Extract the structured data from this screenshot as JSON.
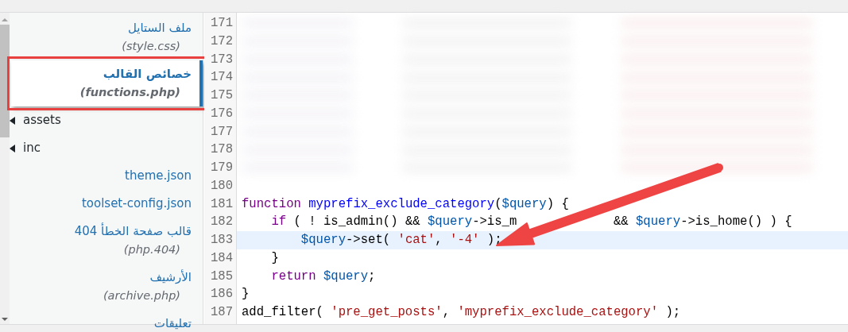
{
  "sidebar": {
    "items": [
      {
        "kind": "file",
        "title": "ملف الستايل",
        "subtitle": "(style.css)",
        "selected": false,
        "outlined": false
      },
      {
        "kind": "file",
        "title": "خصائص القالب",
        "subtitle": "(functions.php)",
        "selected": true,
        "outlined": true
      },
      {
        "kind": "folder",
        "title": "assets",
        "expanded": false
      },
      {
        "kind": "folder",
        "title": "inc",
        "expanded": false
      },
      {
        "kind": "file",
        "title": "theme.json",
        "selected": false,
        "outlined": false
      },
      {
        "kind": "file",
        "title": "toolset-config.json",
        "selected": false,
        "outlined": false
      },
      {
        "kind": "file",
        "title": "قالب صفحة الخطأ 404",
        "subtitle": "(php.404)",
        "selected": false,
        "outlined": false
      },
      {
        "kind": "file",
        "title": "الأرشيف",
        "subtitle": "(archive.php)",
        "selected": false,
        "outlined": false
      },
      {
        "kind": "file",
        "title": "تعليقات",
        "selected": false,
        "outlined": false
      }
    ]
  },
  "editor": {
    "lines": [
      {
        "number": "171",
        "blurred": true
      },
      {
        "number": "172",
        "blurred": true
      },
      {
        "number": "173",
        "blurred": true
      },
      {
        "number": "174",
        "blurred": true
      },
      {
        "number": "175",
        "blurred": true
      },
      {
        "number": "176",
        "blurred": true
      },
      {
        "number": "177",
        "blurred": true
      },
      {
        "number": "178",
        "blurred": true
      },
      {
        "number": "179",
        "blurred": true
      },
      {
        "number": "180",
        "blurred": false
      },
      {
        "number": "181",
        "blurred": false,
        "tokens": [
          {
            "kind": "keyword",
            "text": "function "
          },
          {
            "kind": "def",
            "text": "myprefix_exclude_category"
          },
          {
            "kind": "plain",
            "text": "("
          },
          {
            "kind": "variable",
            "text": "$query"
          },
          {
            "kind": "plain",
            "text": ") {"
          }
        ]
      },
      {
        "number": "182",
        "blurred": false,
        "tokens": [
          {
            "kind": "keyword",
            "text": "    if"
          },
          {
            "kind": "plain",
            "text": " ( ! is_admin() && "
          },
          {
            "kind": "variable",
            "text": "$query"
          },
          {
            "kind": "plain",
            "text": "->is_m"
          },
          {
            "kind": "after_cover",
            "text": "&& "
          },
          {
            "kind": "variable",
            "text": "$query"
          },
          {
            "kind": "plain",
            "text": "->is_home() ) {"
          }
        ]
      },
      {
        "number": "183",
        "blurred": false,
        "active": true,
        "tokens": [
          {
            "kind": "variable",
            "text": "        $query"
          },
          {
            "kind": "plain",
            "text": "->set( "
          },
          {
            "kind": "string",
            "text": "'cat'"
          },
          {
            "kind": "plain",
            "text": ", "
          },
          {
            "kind": "string",
            "text": "'-4'"
          },
          {
            "kind": "plain",
            "text": " );"
          }
        ]
      },
      {
        "number": "184",
        "blurred": false,
        "tokens": [
          {
            "kind": "plain",
            "text": "    }"
          }
        ]
      },
      {
        "number": "185",
        "blurred": false,
        "tokens": [
          {
            "kind": "keyword",
            "text": "    return "
          },
          {
            "kind": "variable",
            "text": "$query"
          },
          {
            "kind": "plain",
            "text": ";"
          }
        ]
      },
      {
        "number": "186",
        "blurred": false,
        "tokens": [
          {
            "kind": "plain",
            "text": "}"
          }
        ]
      },
      {
        "number": "187",
        "blurred": false,
        "tokens": [
          {
            "kind": "plain",
            "text": "add_filter( "
          },
          {
            "kind": "string",
            "text": "'pre_get_posts'"
          },
          {
            "kind": "plain",
            "text": ", "
          },
          {
            "kind": "string",
            "text": "'myprefix_exclude_category'"
          },
          {
            "kind": "plain",
            "text": " );"
          }
        ]
      }
    ]
  }
}
